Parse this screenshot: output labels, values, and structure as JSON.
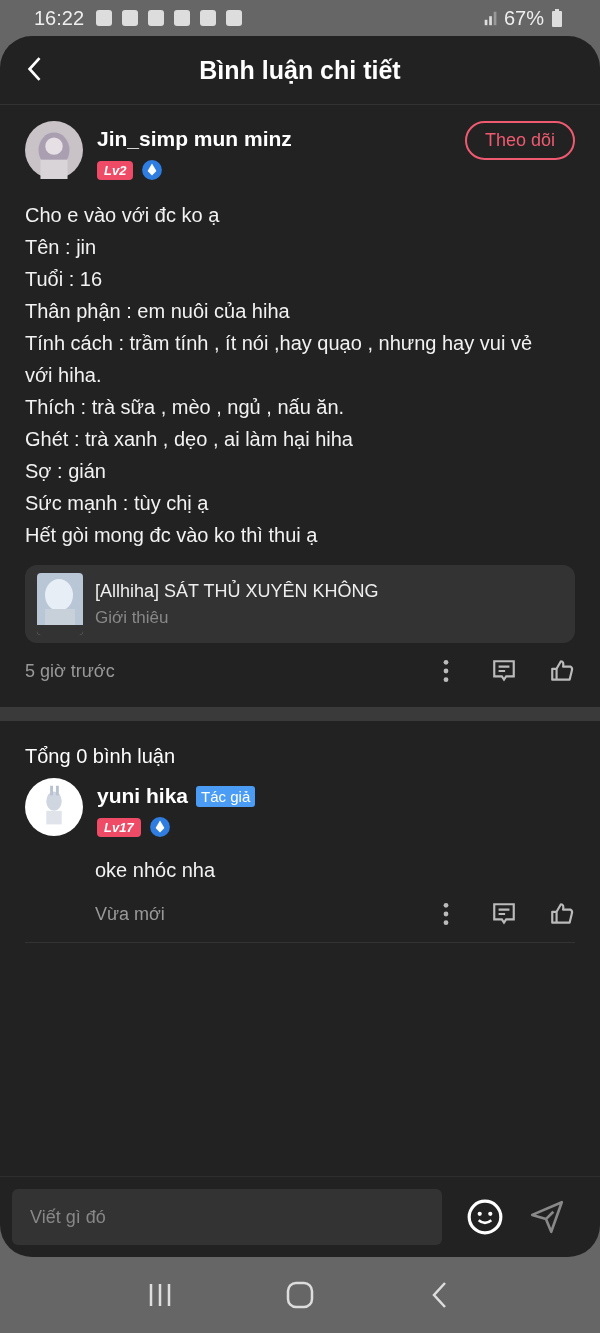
{
  "status_bar": {
    "time": "16:22",
    "battery": "67%"
  },
  "header": {
    "title": "Bình luận chi tiết"
  },
  "post": {
    "author": "Jin_simp mun minz",
    "level": "Lv2",
    "follow": "Theo dõi",
    "lines": [
      "Cho e vào với đc ko ạ",
      "Tên : jin",
      "Tuổi : 16",
      "Thân phận : em nuôi của hiha",
      "Tính cách : trầm tính , ít nói ,hay quạo , nhưng hay vui vẻ với hiha.",
      "Thích : trà sữa , mèo , ngủ , nấu ăn.",
      "Ghét : trà xanh , dẹo , ai làm hại hiha",
      "Sợ : gián",
      "Sức mạnh : tùy chị ạ",
      "Hết gòi mong đc vào ko thì thui ạ"
    ],
    "story": {
      "title": "[Allhiha] SÁT THỦ XUYÊN KHÔNG",
      "subtitle": "Giới thiêu"
    },
    "time": "5 giờ trước"
  },
  "comments_total": "Tổng 0 bình luận",
  "replies": [
    {
      "author": "yuni hika",
      "tag": "Tác giả",
      "level": "Lv17",
      "text": "oke nhóc nha",
      "time": "Vừa mới"
    }
  ],
  "composer": {
    "placeholder": "Viết gì đó"
  }
}
